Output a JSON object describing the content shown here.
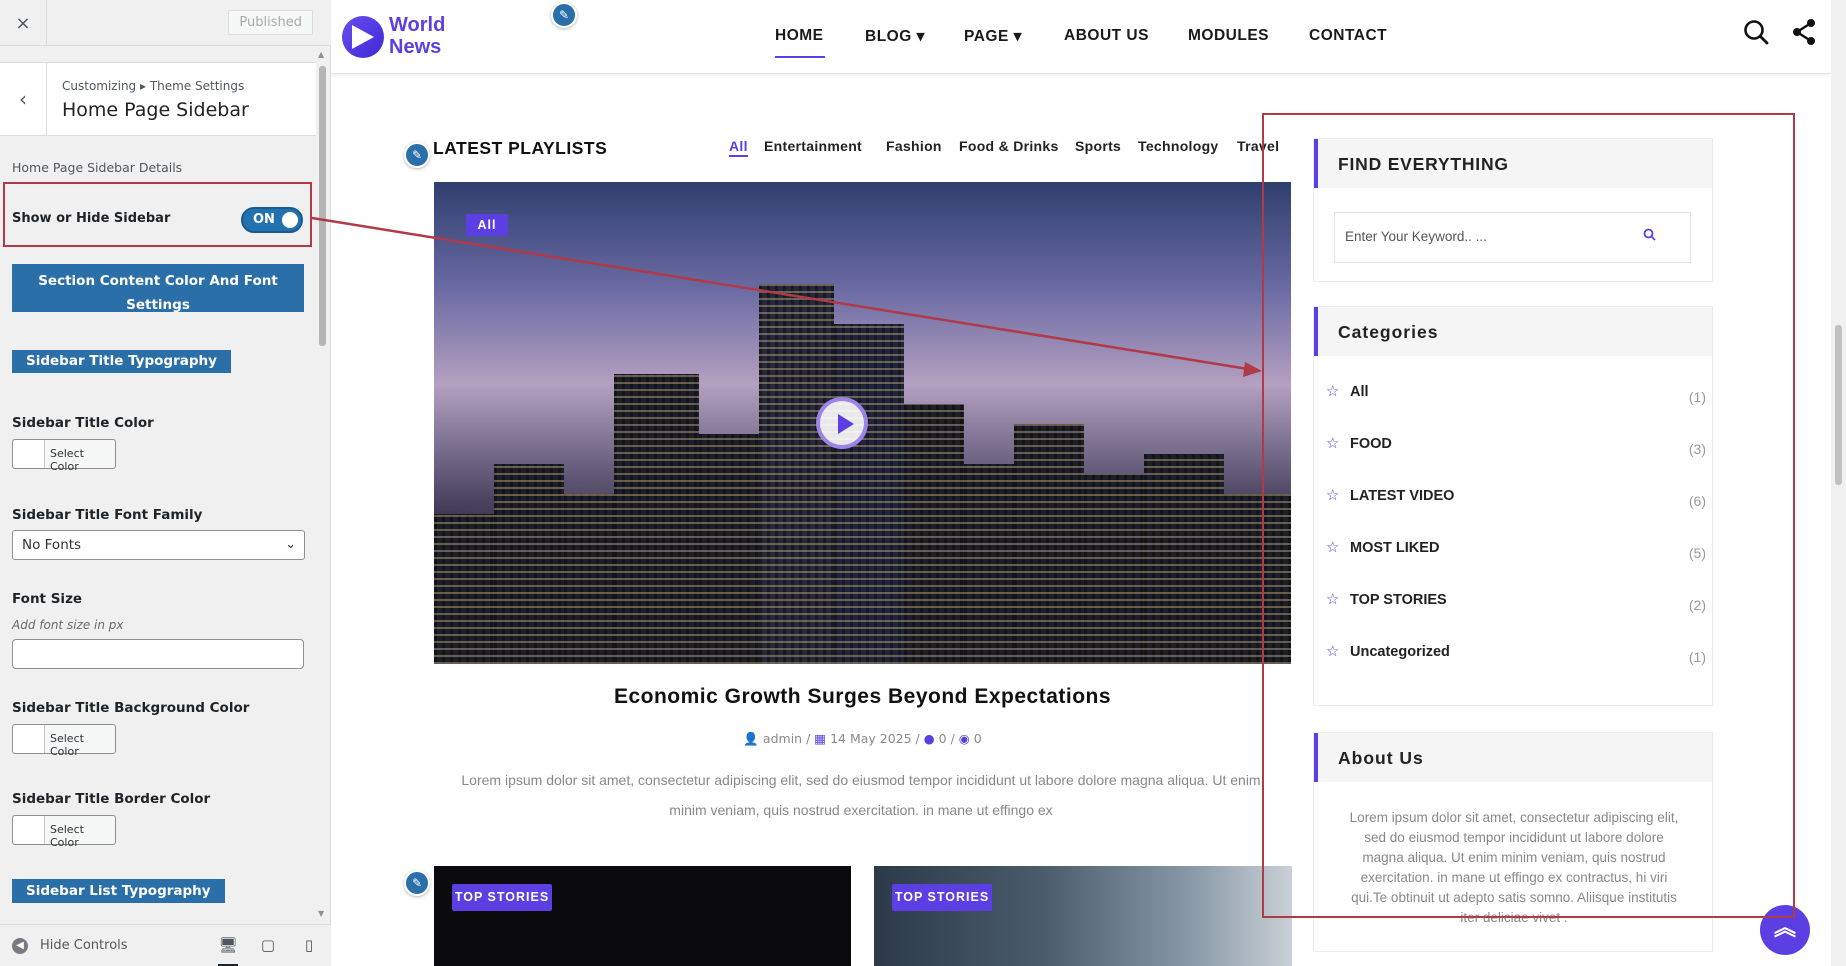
{
  "customizer": {
    "close_icon": "×",
    "published_label": "Published",
    "back_icon": "‹",
    "breadcrumb": "Customizing ▸ Theme Settings",
    "section_title": "Home Page Sidebar",
    "details_label": "Home Page Sidebar Details",
    "show_hide_label": "Show or Hide Sidebar",
    "toggle_state": "ON",
    "section_color_button": "Section Content Color And Font Settings",
    "title_typography_button": "Sidebar Title Typography",
    "title_color_label": "Sidebar Title Color",
    "select_color": "Select Color",
    "font_family_label": "Sidebar Title Font Family",
    "font_family_value": "No Fonts",
    "font_size_label": "Font Size",
    "font_size_hint": "Add font size in px",
    "font_size_value": "",
    "bg_color_label": "Sidebar Title Background Color",
    "border_color_label": "Sidebar Title Border Color",
    "list_typography_button": "Sidebar List Typography",
    "hide_controls": "Hide Controls",
    "toggle_color": "#2271b1",
    "button_color": "#2b6fa8"
  },
  "site": {
    "logo_line1": "World",
    "logo_line2": "News",
    "nav": [
      "HOME",
      "BLOG",
      "PAGE",
      "ABOUT US",
      "MODULES",
      "CONTACT"
    ],
    "nav_dropdown_marker": "▾",
    "accent_color": "#5b3fe2",
    "playlists_title": "LATEST PLAYLISTS",
    "tabs": [
      "All",
      "Entertainment",
      "Fashion",
      "Food & Drinks",
      "Sports",
      "Technology",
      "Travel"
    ],
    "hero_badge": "All",
    "article_title": "Economic Growth Surges Beyond Expectations",
    "meta_author": "admin",
    "meta_date": "14 May 2025",
    "meta_comments": "0",
    "meta_views": "0",
    "excerpt": "Lorem ipsum dolor sit amet, consectetur adipiscing elit, sed do eiusmod tempor incididunt ut labore dolore magna aliqua. Ut enim minim veniam, quis nostrud exercitation. in mane ut effingo ex",
    "card_badge_1": "TOP STORIES",
    "card_badge_2": "TOP STORIES",
    "find_title": "FIND EVERYTHING",
    "search_placeholder": "Enter Your Keyword.. ...",
    "categories_title": "Categories",
    "categories": [
      {
        "name": "All",
        "count": "(1)"
      },
      {
        "name": "FOOD",
        "count": "(3)"
      },
      {
        "name": "LATEST VIDEO",
        "count": "(6)"
      },
      {
        "name": "MOST LIKED",
        "count": "(5)"
      },
      {
        "name": "TOP STORIES",
        "count": "(2)"
      },
      {
        "name": "Uncategorized",
        "count": "(1)"
      }
    ],
    "about_title": "About Us",
    "about_text": "Lorem ipsum dolor sit amet, consectetur adipiscing elit, sed do eiusmod tempor incididunt ut labore dolore magna aliqua. Ut enim minim veniam, quis nostrud exercitation. in mane ut effingo ex contractus, hi viri qui.Te obtinuit ut adepto satis somno. Aliisque institutis iter deliciae vivet ."
  },
  "annotation": {
    "highlight_color": "#b03a48"
  }
}
